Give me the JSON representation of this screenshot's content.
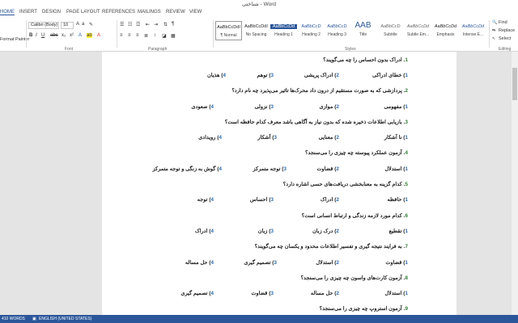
{
  "window": {
    "title": "شناختی - Word"
  },
  "tabs": [
    "HOME",
    "INSERT",
    "DESIGN",
    "PAGE LAYOUT",
    "REFERENCES",
    "MAILINGS",
    "REVIEW",
    "VIEW"
  ],
  "ribbon": {
    "clipboard": {
      "format_painter": "Format Painter"
    },
    "font": {
      "font_name": "Calibri (Body)",
      "font_size": "10",
      "label": "Font"
    },
    "paragraph": {
      "label": "Paragraph"
    },
    "styles": {
      "label": "Styles",
      "items": [
        {
          "preview": "AaBbCcDdI",
          "name": "¶ Normal"
        },
        {
          "preview": "AaBbCcDdI",
          "name": "No Spacing"
        },
        {
          "preview": "AaBbCcDd",
          "name": "Heading 1"
        },
        {
          "preview": "AaBbCcD",
          "name": "Heading 2"
        },
        {
          "preview": "AaBbCcD",
          "name": "Heading 3"
        },
        {
          "preview": "AAB",
          "name": "Title"
        },
        {
          "preview": "AaBbCcD",
          "name": "Subtitle"
        },
        {
          "preview": "AaBbCcDd",
          "name": "Subtle Em..."
        },
        {
          "preview": "AaBbCcDd",
          "name": "Emphasis"
        },
        {
          "preview": "AaBbCcDd",
          "name": "Intense E..."
        }
      ]
    },
    "editing": {
      "find": "Find",
      "replace": "Replace",
      "select": "Select",
      "label": "Editing"
    }
  },
  "questions": [
    {
      "num": "1",
      "text": "ادراک بدون احساس را چه می‌گویند؟",
      "options": [
        {
          "n": "1",
          "t": "خطای ادراکی"
        },
        {
          "n": "2",
          "t": "ادراک پریشی"
        },
        {
          "n": "3",
          "t": "توهم"
        },
        {
          "n": "4",
          "t": "هذیان"
        }
      ]
    },
    {
      "num": "2",
      "text": "پردازشی که به صورت مستقیم از درون داد محرک‌ها تاثیر می‌پذیرد چه نام دارد؟",
      "options": [
        {
          "n": "1",
          "t": "مفهومی"
        },
        {
          "n": "2",
          "t": "موازی"
        },
        {
          "n": "3",
          "t": "نزولی"
        },
        {
          "n": "4",
          "t": "صعودی"
        }
      ]
    },
    {
      "num": "3",
      "text": "بازیابی اطلاعات ذخیره شده که بدون نیاز به آگاهی باشد معرف کدام حافظه است؟",
      "options": [
        {
          "n": "1",
          "t": "نا آشکار"
        },
        {
          "n": "2",
          "t": "معنایی"
        },
        {
          "n": "3",
          "t": "آشکار"
        },
        {
          "n": "4",
          "t": "رویدادی"
        }
      ]
    },
    {
      "num": "4",
      "text": "آزمون عملکرد پیوسته چه چیزی را می‌سنجد؟",
      "options": [
        {
          "n": "1",
          "t": "استدلال"
        },
        {
          "n": "2",
          "t": "قضاوت"
        },
        {
          "n": "3",
          "t": "توجه متمرکز"
        },
        {
          "n": "4",
          "t": "گوش به زنگی و توجه متمرکز"
        }
      ]
    },
    {
      "num": "5",
      "text": "کدام گزینه به معنابخشی دریافت‌های حسی اشاره دارد؟",
      "options": [
        {
          "n": "1",
          "t": "حافظه"
        },
        {
          "n": "2",
          "t": "ادراک"
        },
        {
          "n": "3",
          "t": "احساس"
        },
        {
          "n": "4",
          "t": "توجه"
        }
      ]
    },
    {
      "num": "6",
      "text": "کدام مورد لازمه زندگی و ارتباط انسانی است؟",
      "options": [
        {
          "n": "1",
          "t": "تقطیع"
        },
        {
          "n": "2",
          "t": "درک زبان"
        },
        {
          "n": "3",
          "t": "زبان"
        },
        {
          "n": "4",
          "t": "ادراک"
        }
      ]
    },
    {
      "num": "7",
      "text": "به فرایند نتیجه گیری و تفسیر اطلاعات محدود و یکسان چه می‌گویند؟",
      "options": [
        {
          "n": "1",
          "t": "قضاوت"
        },
        {
          "n": "2",
          "t": "استدلال"
        },
        {
          "n": "3",
          "t": "تصمیم گیری"
        },
        {
          "n": "4",
          "t": "حل مساله"
        }
      ]
    },
    {
      "num": "8",
      "text": "آزمون کارت‌های واسون چه چیزی را می‌سنجد؟",
      "options": [
        {
          "n": "1",
          "t": "استدلال"
        },
        {
          "n": "2",
          "t": "حل مساله"
        },
        {
          "n": "3",
          "t": "قضاوت"
        },
        {
          "n": "4",
          "t": "تصمیم گیری"
        }
      ]
    },
    {
      "num": "9",
      "text": "آزمون استروپ چه چیزی را می‌سنجد؟",
      "options": []
    }
  ],
  "status": {
    "words": "410 WORDS",
    "language": "ENGLISH (UNITED STATES)"
  }
}
